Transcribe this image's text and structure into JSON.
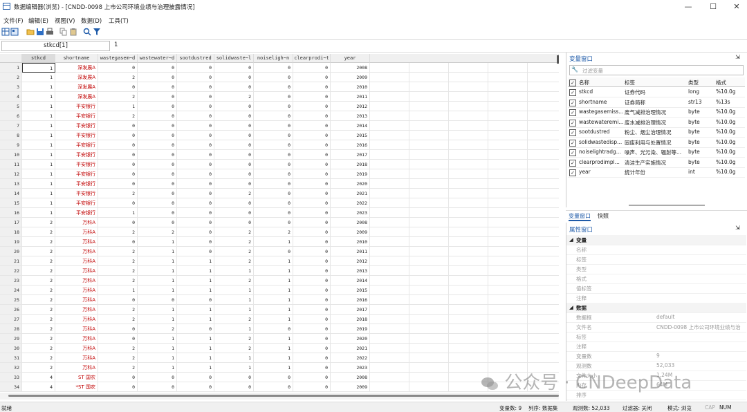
{
  "window": {
    "title": "数据编辑器(浏览) - [CNDD-0098 上市公司环境业绩与治理披露情况]",
    "min": "—",
    "max": "☐",
    "close": "✕"
  },
  "menu": [
    "文件(F)",
    "编辑(E)",
    "视图(V)",
    "数据(D)",
    "工具(T)"
  ],
  "edit": {
    "cell_ref": "stkcd[1]",
    "cell_value": "1"
  },
  "grid": {
    "columns": [
      "stkcd",
      "shortname",
      "wastegasem~d",
      "wastewater~d",
      "sootdustred",
      "solidwaste~l",
      "noiseligh~n",
      "clearprodi~t",
      "year"
    ],
    "rows": [
      [
        "1",
        "1",
        "深发展A",
        "0",
        "0",
        "0",
        "0",
        "0",
        "0",
        "2008"
      ],
      [
        "2",
        "1",
        "深发展A",
        "2",
        "0",
        "0",
        "0",
        "0",
        "0",
        "2009"
      ],
      [
        "3",
        "1",
        "深发展A",
        "0",
        "0",
        "0",
        "0",
        "0",
        "0",
        "2010"
      ],
      [
        "4",
        "1",
        "深发展A",
        "2",
        "0",
        "0",
        "2",
        "0",
        "0",
        "2011"
      ],
      [
        "5",
        "1",
        "平安银行",
        "1",
        "0",
        "0",
        "0",
        "0",
        "0",
        "2012"
      ],
      [
        "6",
        "1",
        "平安银行",
        "2",
        "0",
        "0",
        "0",
        "0",
        "0",
        "2013"
      ],
      [
        "7",
        "1",
        "平安银行",
        "0",
        "0",
        "0",
        "0",
        "0",
        "0",
        "2014"
      ],
      [
        "8",
        "1",
        "平安银行",
        "0",
        "0",
        "0",
        "0",
        "0",
        "0",
        "2015"
      ],
      [
        "9",
        "1",
        "平安银行",
        "0",
        "0",
        "0",
        "0",
        "0",
        "0",
        "2016"
      ],
      [
        "10",
        "1",
        "平安银行",
        "0",
        "0",
        "0",
        "0",
        "0",
        "0",
        "2017"
      ],
      [
        "11",
        "1",
        "平安银行",
        "0",
        "0",
        "0",
        "0",
        "0",
        "0",
        "2018"
      ],
      [
        "12",
        "1",
        "平安银行",
        "0",
        "0",
        "0",
        "0",
        "0",
        "0",
        "2019"
      ],
      [
        "13",
        "1",
        "平安银行",
        "0",
        "0",
        "0",
        "0",
        "0",
        "0",
        "2020"
      ],
      [
        "14",
        "1",
        "平安银行",
        "2",
        "0",
        "0",
        "2",
        "0",
        "0",
        "2021"
      ],
      [
        "15",
        "1",
        "平安银行",
        "0",
        "0",
        "0",
        "0",
        "0",
        "0",
        "2022"
      ],
      [
        "16",
        "1",
        "平安银行",
        "1",
        "0",
        "0",
        "0",
        "0",
        "0",
        "2023"
      ],
      [
        "17",
        "2",
        "万科A",
        "0",
        "0",
        "0",
        "0",
        "0",
        "0",
        "2008"
      ],
      [
        "18",
        "2",
        "万科A",
        "2",
        "2",
        "0",
        "2",
        "2",
        "0",
        "2009"
      ],
      [
        "19",
        "2",
        "万科A",
        "0",
        "1",
        "0",
        "2",
        "1",
        "0",
        "2010"
      ],
      [
        "20",
        "2",
        "万科A",
        "2",
        "1",
        "0",
        "2",
        "0",
        "0",
        "2011"
      ],
      [
        "21",
        "2",
        "万科A",
        "2",
        "1",
        "1",
        "2",
        "1",
        "0",
        "2012"
      ],
      [
        "22",
        "2",
        "万科A",
        "2",
        "1",
        "1",
        "1",
        "1",
        "0",
        "2013"
      ],
      [
        "23",
        "2",
        "万科A",
        "2",
        "1",
        "1",
        "2",
        "1",
        "0",
        "2014"
      ],
      [
        "24",
        "2",
        "万科A",
        "1",
        "1",
        "1",
        "1",
        "1",
        "0",
        "2015"
      ],
      [
        "25",
        "2",
        "万科A",
        "0",
        "0",
        "0",
        "1",
        "1",
        "0",
        "2016"
      ],
      [
        "26",
        "2",
        "万科A",
        "2",
        "1",
        "1",
        "1",
        "1",
        "0",
        "2017"
      ],
      [
        "27",
        "2",
        "万科A",
        "2",
        "1",
        "1",
        "2",
        "1",
        "0",
        "2018"
      ],
      [
        "28",
        "2",
        "万科A",
        "0",
        "2",
        "0",
        "1",
        "0",
        "0",
        "2019"
      ],
      [
        "29",
        "2",
        "万科A",
        "0",
        "1",
        "1",
        "2",
        "1",
        "0",
        "2020"
      ],
      [
        "30",
        "2",
        "万科A",
        "2",
        "1",
        "1",
        "2",
        "1",
        "0",
        "2021"
      ],
      [
        "31",
        "2",
        "万科A",
        "2",
        "1",
        "1",
        "1",
        "1",
        "0",
        "2022"
      ],
      [
        "32",
        "2",
        "万科A",
        "2",
        "1",
        "1",
        "1",
        "1",
        "0",
        "2023"
      ],
      [
        "33",
        "4",
        "ST 国农",
        "0",
        "0",
        "0",
        "0",
        "0",
        "0",
        "2008"
      ],
      [
        "34",
        "4",
        "*ST 国农",
        "0",
        "0",
        "0",
        "0",
        "0",
        "0",
        "2009"
      ]
    ]
  },
  "varwin": {
    "title": "变量窗口",
    "filter_placeholder": "过滤变量",
    "headers": [
      "名称",
      "标签",
      "类型",
      "格式"
    ],
    "vars": [
      [
        "stkcd",
        "证券代码",
        "long",
        "%10.0g"
      ],
      [
        "shortname",
        "证券简称",
        "str13",
        "%13s"
      ],
      [
        "wastegasemiss...",
        "废气减排治理情况",
        "byte",
        "%10.0g"
      ],
      [
        "wastewateremi...",
        "废水减排治理情况",
        "byte",
        "%10.0g"
      ],
      [
        "sootdustred",
        "粉尘、烟尘治理情况",
        "byte",
        "%10.0g"
      ],
      [
        "solidwastedisp...",
        "固废利用与处置情况",
        "byte",
        "%10.0g"
      ],
      [
        "noiselightradg...",
        "噪声、光污染、辐射等...",
        "byte",
        "%10.0g"
      ],
      [
        "clearprodimpl...",
        "清洁生产实施情况",
        "byte",
        "%10.0g"
      ],
      [
        "year",
        "统计年份",
        "int",
        "%10.0g"
      ]
    ]
  },
  "tabs": [
    "变量窗口",
    "快照"
  ],
  "propwin": {
    "title": "属性窗口",
    "sec_var": "变量",
    "var_keys": [
      "名称",
      "标签",
      "类型",
      "格式",
      "值标签",
      "注释"
    ],
    "sec_data": "数据",
    "data_rows": [
      [
        "数据框",
        "default"
      ],
      [
        "文件名",
        "CNDD-0098 上市公司环境业绩与治"
      ],
      [
        "标签",
        ""
      ],
      [
        "注释",
        ""
      ],
      [
        "变量数",
        "9"
      ],
      [
        "观测数",
        "52,033"
      ],
      [
        "文件大小",
        "1.24M"
      ],
      [
        "内存",
        "64M"
      ],
      [
        "排序",
        ""
      ]
    ]
  },
  "status": {
    "ready": "就绪",
    "vars": "变量数: 9",
    "order": "列序: 数据集",
    "obs": "观测数: 52,033",
    "filter": "过滤器: 关闭",
    "mode": "模式: 浏览",
    "cap": "CAP",
    "num": "NUM"
  },
  "watermark": "公众号 · CNDeepData"
}
